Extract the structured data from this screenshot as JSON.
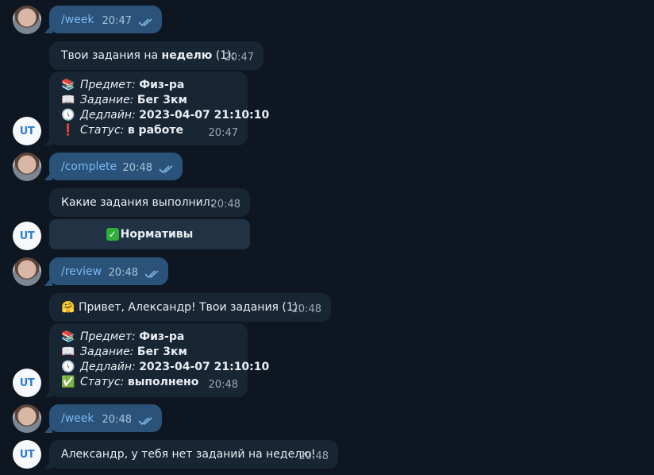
{
  "messages": {
    "m1": {
      "text": "/week",
      "time": "20:47"
    },
    "m2": {
      "prefix": "Твои задания на ",
      "bold": "неделю",
      "suffix": " (1):",
      "time": "20:47"
    },
    "m3": {
      "subject_label": "Предмет:",
      "subject": "Физ-ра",
      "task_label": "Задание:",
      "task": "Бег 3км",
      "deadline_label": "Дедлайн:",
      "deadline": "2023-04-07 21:10:10",
      "status_label": "Статус:",
      "status": "в работе",
      "time": "20:47"
    },
    "m4": {
      "text": "/complete",
      "time": "20:48"
    },
    "m5": {
      "text": "Какие задания выполнил:",
      "time": "20:48"
    },
    "m5_button": {
      "check": "✅",
      "label": "Нормативы"
    },
    "m6": {
      "text": "/review",
      "time": "20:48"
    },
    "m7": {
      "emoji": "🤗",
      "text": "Привет, Александр! Твои задания (1):",
      "time": "20:48"
    },
    "m8": {
      "subject_label": "Предмет:",
      "subject": "Физ-ра",
      "task_label": "Задание:",
      "task": "Бег 3км",
      "deadline_label": "Дедлайн:",
      "deadline": "2023-04-07 21:10:10",
      "status_label": "Статус:",
      "status": "выполнено",
      "time": "20:48"
    },
    "m9": {
      "text": "/week",
      "time": "20:48"
    },
    "m10": {
      "text": "Александр, у тебя нет заданий на неделю!",
      "time": "20:48"
    }
  },
  "bot_avatar_text": "UT",
  "icons": {
    "books": "📚",
    "book": "📖",
    "clock": "🕔",
    "exclamation": "❗",
    "check": "✅"
  },
  "colors": {
    "background": "#0e1621",
    "outgoing": "#2b5278",
    "incoming": "#182533",
    "command_link": "#79b8f4"
  }
}
